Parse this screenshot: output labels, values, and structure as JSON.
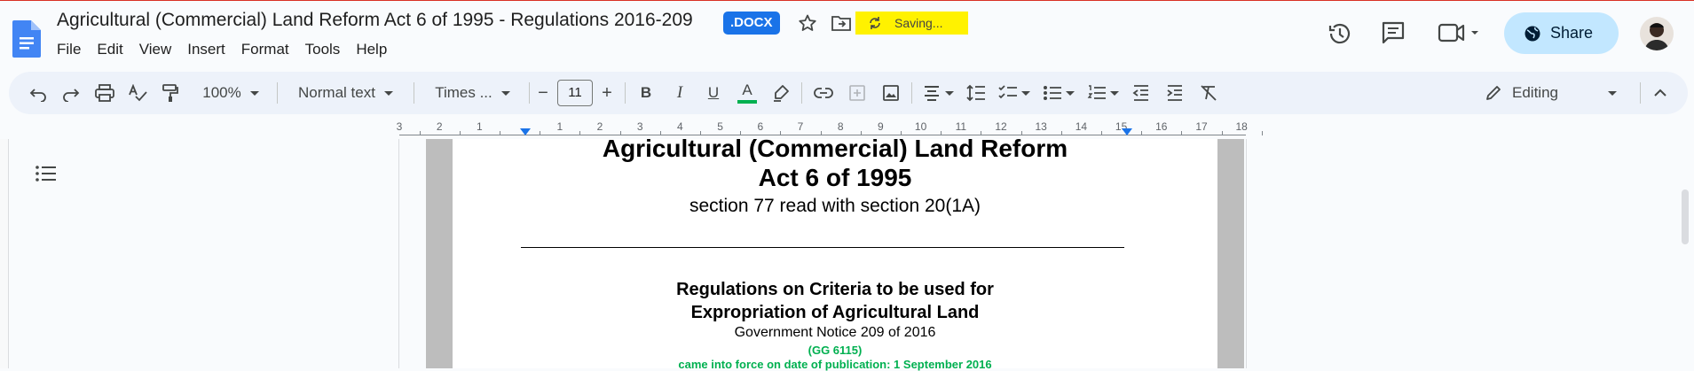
{
  "window": {
    "doc_title": "Agricultural (Commercial) Land Reform Act 6 of 1995 - Regulations 2016-209",
    "file_badge": ".DOCX",
    "saving_status": "Saving...",
    "share_label": "Share"
  },
  "menu": [
    "File",
    "Edit",
    "View",
    "Insert",
    "Format",
    "Tools",
    "Help"
  ],
  "toolbar": {
    "zoom": "100%",
    "style": "Normal text",
    "font": "Times ...",
    "font_size": "11",
    "mode": "Editing",
    "bold": "B",
    "italic": "I",
    "underline": "U",
    "text_color": "A",
    "minus": "−",
    "plus": "+"
  },
  "ruler": {
    "labels": [
      "3",
      "2",
      "1",
      "",
      "1",
      "2",
      "3",
      "4",
      "5",
      "6",
      "7",
      "8",
      "9",
      "10",
      "11",
      "12",
      "13",
      "14",
      "15",
      "16",
      "17",
      "18"
    ]
  },
  "document": {
    "heading_line1": "Agricultural (Commercial) Land Reform",
    "heading_line2": "Act 6 of 1995",
    "section": "section 77 read with section 20(1A)",
    "reg_title_line1": "Regulations on Criteria to be used for",
    "reg_title_line2": "Expropriation of Agricultural Land",
    "notice": "Government Notice 209 of 2016",
    "gazette": "(GG 6115)",
    "in_force": "came into force on date of publication: 1 September 2016"
  },
  "colors": {
    "accent": "#1a73e8",
    "share_bg": "#c2e7ff",
    "saving_highlight": "#fff200",
    "green_text": "#00b050"
  },
  "icons": [
    "docs-logo-icon",
    "star-icon",
    "move-to-folder-icon",
    "sync-icon",
    "history-icon",
    "comment-icon",
    "meet-icon",
    "globe-icon",
    "undo-icon",
    "redo-icon",
    "print-icon",
    "spellcheck-icon",
    "paint-format-icon",
    "highlighter-icon",
    "link-icon",
    "add-comment-icon",
    "image-icon",
    "align-icon",
    "line-spacing-icon",
    "checklist-icon",
    "bulleted-list-icon",
    "numbered-list-icon",
    "decrease-indent-icon",
    "increase-indent-icon",
    "clear-formatting-icon",
    "pencil-icon",
    "chevron-up-icon",
    "outline-icon"
  ]
}
